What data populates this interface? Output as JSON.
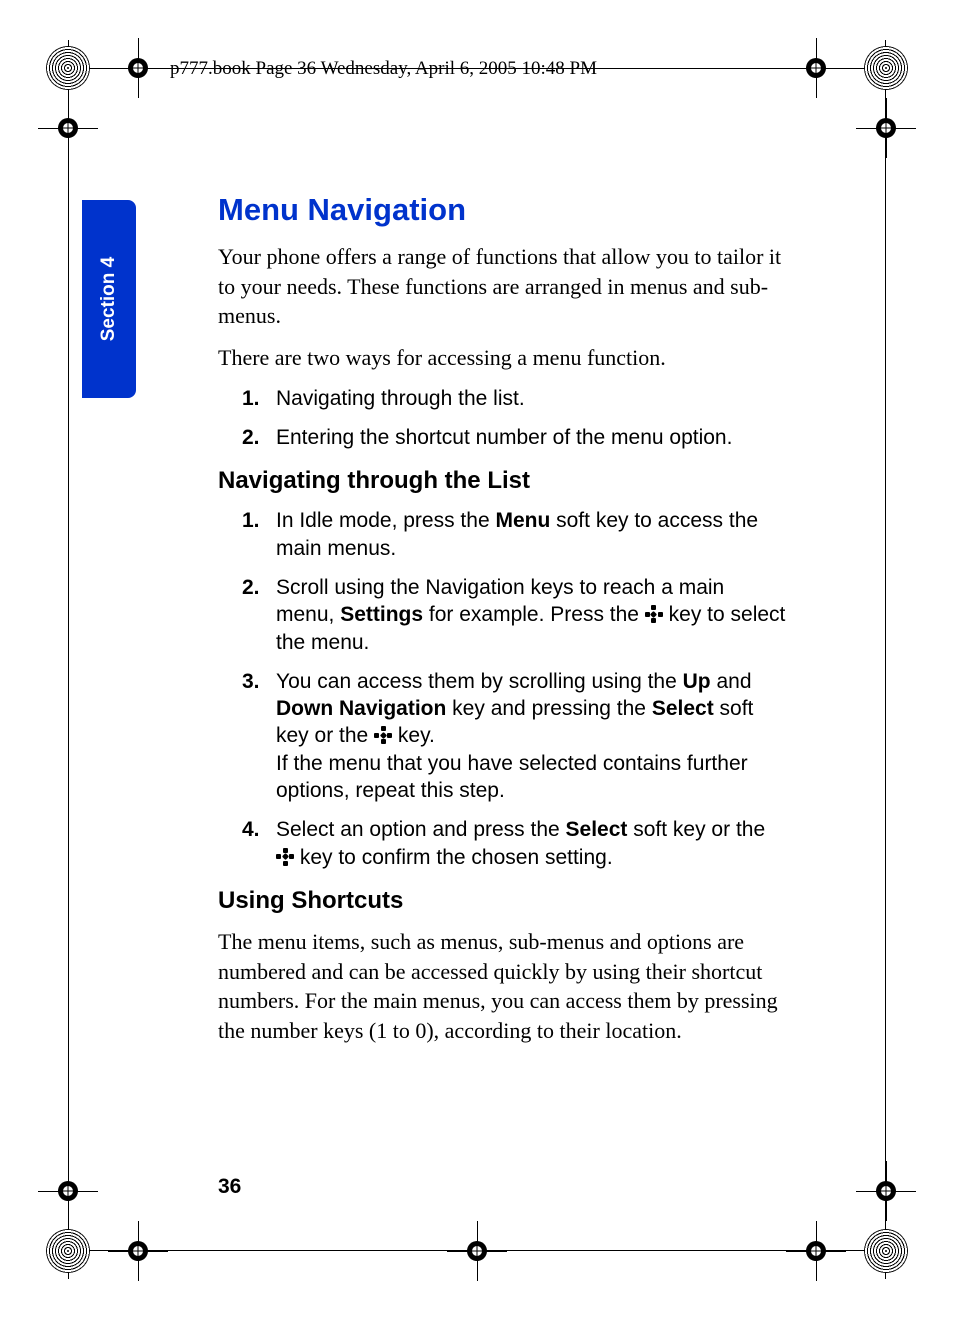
{
  "header": "p777.book  Page 36  Wednesday, April 6, 2005  10:48 PM",
  "section_tab": "Section 4",
  "title": "Menu Navigation",
  "intro_p1": "Your phone offers a range of functions that allow you to tailor it to your needs. These functions are arranged in menus and sub-menus.",
  "intro_p2": "There are two ways for accessing a menu function.",
  "access_list": {
    "item1_num": "1.",
    "item1_text": "Navigating through the list.",
    "item2_num": "2.",
    "item2_text": "Entering the shortcut number of the menu option."
  },
  "subhead1": "Navigating through the List",
  "nav_list": {
    "i1_num": "1.",
    "i1_a": "In Idle mode, press the ",
    "i1_b": "Menu",
    "i1_c": " soft key to access the main menus.",
    "i2_num": "2.",
    "i2_a": "Scroll using the Navigation keys to reach a main menu, ",
    "i2_b": "Settings",
    "i2_c": " for example. Press the ",
    "i2_d": " key to select the menu.",
    "i3_num": "3.",
    "i3_a": "You can access them by scrolling using the ",
    "i3_b": "Up",
    "i3_c": " and ",
    "i3_d": "Down Navigation",
    "i3_e": " key and pressing the ",
    "i3_f": "Select",
    "i3_g": " soft key or the ",
    "i3_h": " key.",
    "i3_i": "If the menu that you have selected contains further options, repeat this step.",
    "i4_num": "4.",
    "i4_a": "Select an option and press the ",
    "i4_b": "Select",
    "i4_c": " soft key or the ",
    "i4_d": " key to confirm the chosen setting."
  },
  "subhead2": "Using Shortcuts",
  "shortcuts_p": "The menu items, such as menus, sub-menus and options are numbered and can be accessed quickly by using their shortcut numbers. For the main menus, you can access them by pressing the number keys (1 to 0), according to their location.",
  "page_number": "36"
}
